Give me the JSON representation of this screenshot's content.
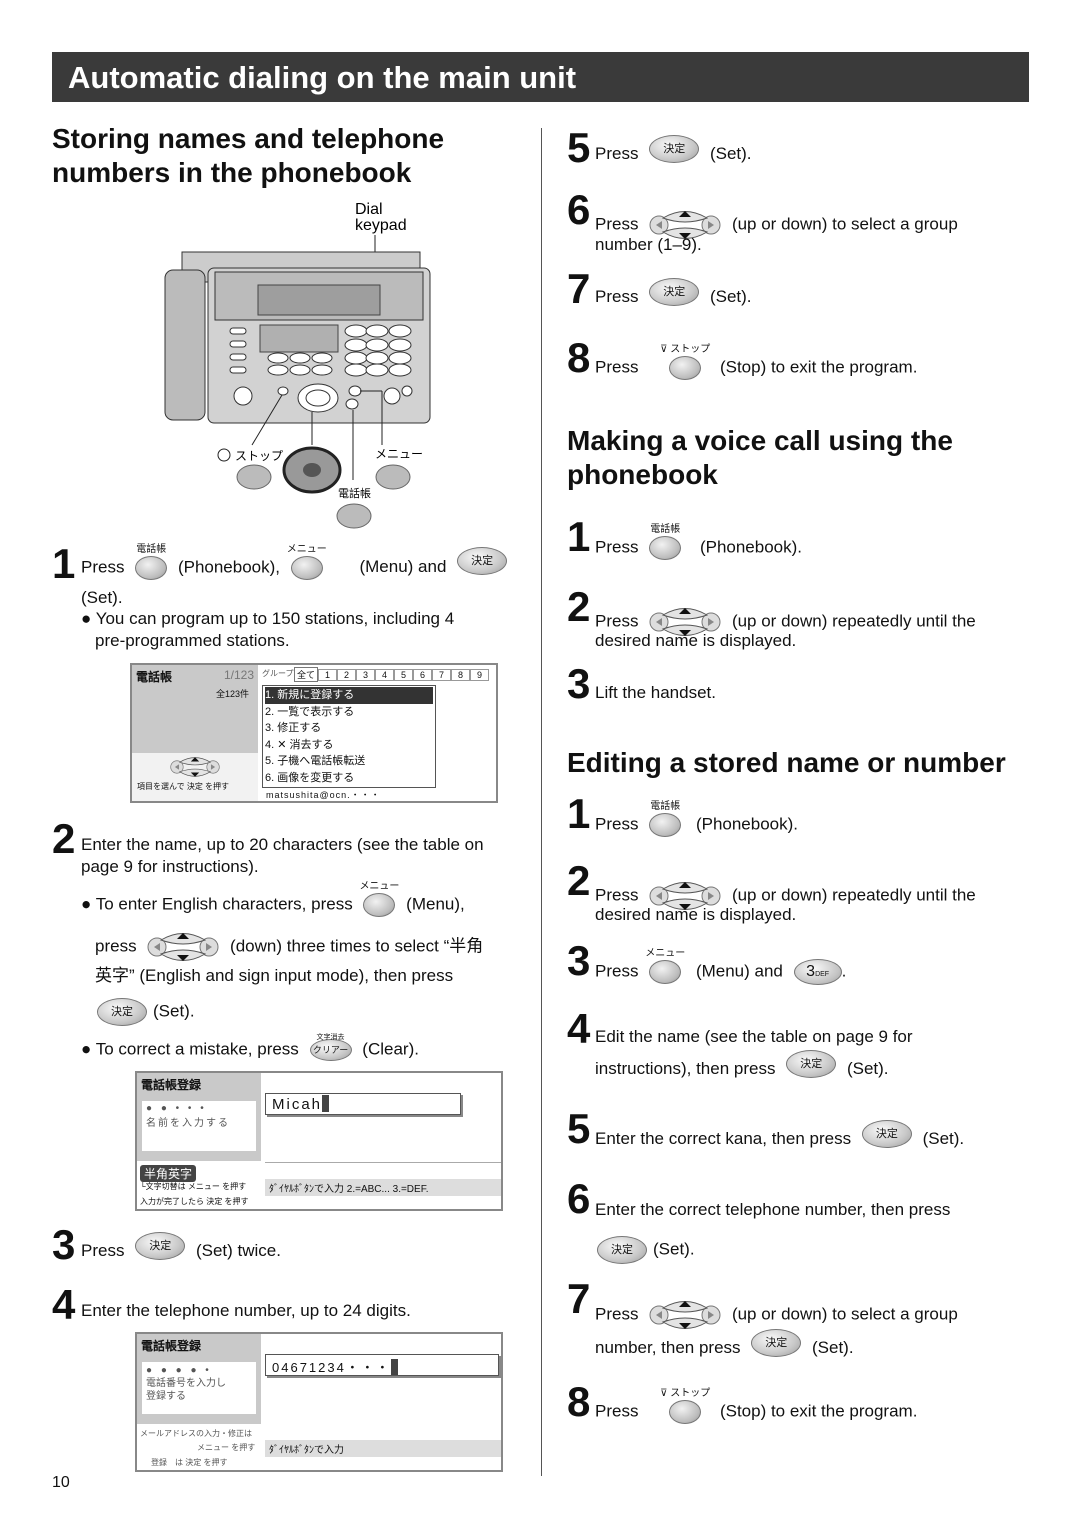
{
  "title": "Automatic dialing on the main unit",
  "page_number": "10",
  "keys": {
    "set": "決定",
    "phonebook": "電話帳",
    "menu": "メニュー",
    "stop": "ストップ",
    "clear": "クリアー",
    "clear_caption": "文字消去",
    "three": "3",
    "three_sub": "DEF"
  },
  "illustration": {
    "dial_keypad": "Dial\nkeypad",
    "stop": "ストップ",
    "menu": "メニュー",
    "phonebook": "電話帳"
  },
  "storing": {
    "heading": "Storing names and telephone numbers in the phonebook",
    "s1": {
      "n": "1",
      "press": "Press",
      "t1": "(Phonebook),",
      "t2": "(Menu) and",
      "t3": "(Set).",
      "bullet": "You can program up to 150 stations, including 4",
      "bullet2": "pre-programmed stations."
    },
    "screen1": {
      "title": "電話帳",
      "count": "1/123",
      "total": "全123件",
      "group": "グループ",
      "all": "全て",
      "tabs": [
        "1",
        "2",
        "3",
        "4",
        "5",
        "6",
        "7",
        "8",
        "9"
      ],
      "menu": [
        "1. 新規に登録する",
        "2. 一覧で表示する",
        "3. 修正する",
        "4. ✕ 消去する",
        "5. 子機へ電話帳転送",
        "6. 画像を変更する"
      ],
      "email": "matsushita@ocn.・・・",
      "hint": "項目を選んで 決定 を押す"
    },
    "s2": {
      "n": "2",
      "l1": "Enter the name, up to 20 characters (see the table on",
      "l2": "page 9 for instructions).",
      "b1a": "To enter English characters, press",
      "b1b": "(Menu),",
      "b2a": "press",
      "b2b": "(down) three times to select “半角",
      "b3": "英字” (English and sign input mode), then press",
      "b4": "(Set).",
      "b5a": "To correct a mistake, press",
      "b5b": "(Clear)."
    },
    "screen2": {
      "title": "電話帳登録",
      "prompt": "名前を入力する",
      "value": "Micah",
      "mode": "半角英字",
      "hint1": "└文字切替は メニュー を押す",
      "hint2": "入力が完了したら 決定 を押す",
      "footer": "ﾀﾞｲﾔﾙﾎﾞﾀﾝで入力  2.=ABC...  3.=DEF."
    },
    "s3": {
      "n": "3",
      "press": "Press",
      "t": "(Set) twice."
    },
    "s4": {
      "n": "4",
      "t": "Enter the telephone number, up to 24 digits."
    },
    "screen3": {
      "title": "電話帳登録",
      "prompt": "電話番号を入力し\n登録する",
      "value": "04671234・・・",
      "hint1": "メールアドレスの入力・修正は",
      "hint2": "メニュー を押す",
      "hint3": "登録　は 決定 を押す",
      "footer": "ﾀﾞｲﾔﾙﾎﾞﾀﾝで入力"
    }
  },
  "storing_cont": {
    "s5": {
      "n": "5",
      "press": "Press",
      "t": "(Set)."
    },
    "s6": {
      "n": "6",
      "press": "Press",
      "t": "(up or down) to select a group",
      "t2": "number (1–9)."
    },
    "s7": {
      "n": "7",
      "press": "Press",
      "t": "(Set)."
    },
    "s8": {
      "n": "8",
      "press": "Press",
      "t": "(Stop) to exit the program."
    }
  },
  "voice": {
    "heading": "Making a voice call using the phonebook",
    "s1": {
      "n": "1",
      "press": "Press",
      "t": "(Phonebook)."
    },
    "s2": {
      "n": "2",
      "press": "Press",
      "t": "(up or down) repeatedly until the",
      "t2": "desired name is displayed."
    },
    "s3": {
      "n": "3",
      "t": "Lift the handset."
    }
  },
  "editing": {
    "heading": "Editing a stored name or number",
    "s1": {
      "n": "1",
      "press": "Press",
      "t": "(Phonebook)."
    },
    "s2": {
      "n": "2",
      "press": "Press",
      "t": "(up or down) repeatedly until the",
      "t2": "desired name is displayed."
    },
    "s3": {
      "n": "3",
      "press": "Press",
      "t": "(Menu) and",
      "t2": "."
    },
    "s4": {
      "n": "4",
      "t": "Edit the name (see the table on page 9 for",
      "t2": "instructions), then press",
      "t3": "(Set)."
    },
    "s5": {
      "n": "5",
      "t": "Enter the correct kana, then press",
      "t2": "(Set)."
    },
    "s6": {
      "n": "6",
      "t": "Enter the correct telephone number, then press",
      "t2": "(Set)."
    },
    "s7": {
      "n": "7",
      "press": "Press",
      "t": "(up or down) to select a group",
      "t2": "number, then press",
      "t3": "(Set)."
    },
    "s8": {
      "n": "8",
      "press": "Press",
      "t": "(Stop) to exit the program."
    }
  }
}
